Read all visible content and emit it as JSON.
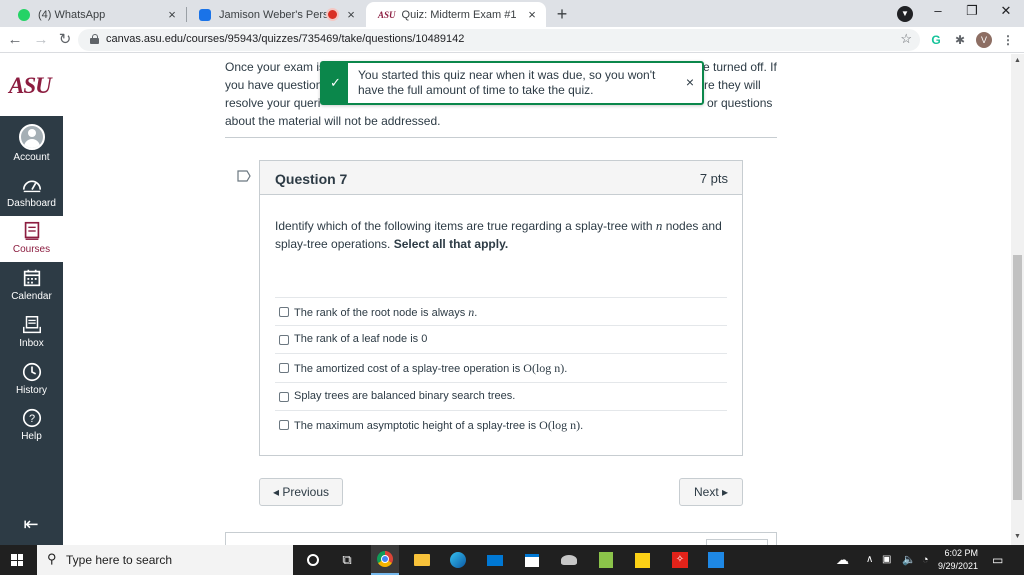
{
  "browser": {
    "tabs": [
      {
        "title": "(4) WhatsApp",
        "close": "×",
        "color": "#25d366"
      },
      {
        "title": "Jamison Weber's Personal M",
        "close": "×",
        "color": "#1a73e8",
        "recording": true
      },
      {
        "title": "Quiz: Midterm Exam #1",
        "close": "×",
        "color": "#8c1d40",
        "active": true
      }
    ],
    "new_tab": "+",
    "window_controls": {
      "minimize": "–",
      "restore": "❐",
      "close": "✕"
    },
    "url": "canvas.asu.edu/courses/95943/quizzes/735469/take/questions/10489142",
    "extension_v": "V"
  },
  "sidebar": {
    "logo": "ASU",
    "items": [
      {
        "label": "Account",
        "icon": "account-avatar-icon"
      },
      {
        "label": "Dashboard",
        "icon": "dashboard-gauge-icon"
      },
      {
        "label": "Courses",
        "icon": "courses-book-icon",
        "active": true
      },
      {
        "label": "Calendar",
        "icon": "calendar-icon"
      },
      {
        "label": "Inbox",
        "icon": "inbox-icon"
      },
      {
        "label": "History",
        "icon": "history-clock-icon"
      },
      {
        "label": "Help",
        "icon": "help-question-icon"
      }
    ],
    "collapse_icon": "collapse-arrow-icon"
  },
  "intro": {
    "l1a": "Once your exam is",
    "l1b": "e turned off. If",
    "l2a": "you have question",
    "l2b": "re they will",
    "l3a": "resolve your queri",
    "l3b": "or questions",
    "l4": "about the material will not be addressed."
  },
  "flash": {
    "message": "You started this quiz near when it was due, so you won't have the full amount of time to take the quiz.",
    "close": "×"
  },
  "question": {
    "name": "Question 7",
    "points": "7 pts",
    "text_part1": "Identify which of the following items are true regarding a splay-tree with ",
    "var_n": "n",
    "text_part2": " nodes and splay-tree operations. ",
    "text_bold": "Select all that apply.",
    "answers": [
      {
        "text": "The rank of the root node is always ",
        "math": "n",
        "tail": "."
      },
      {
        "text": "The rank of a leaf node is 0",
        "math": "",
        "tail": ""
      },
      {
        "text": "The amortized cost of a splay-tree operation is ",
        "math": "O(log n)",
        "tail": "."
      },
      {
        "text": "Splay trees are balanced binary search trees.",
        "math": "",
        "tail": ""
      },
      {
        "text": "The maximum asymptotic height of a splay-tree is ",
        "math": "O(log n)",
        "tail": "."
      }
    ]
  },
  "nav": {
    "previous": "◂  Previous",
    "next": "Next  ▸"
  },
  "taskbar": {
    "search_placeholder": "Type here to search",
    "time": "6:02 PM",
    "date": "9/29/2021"
  }
}
